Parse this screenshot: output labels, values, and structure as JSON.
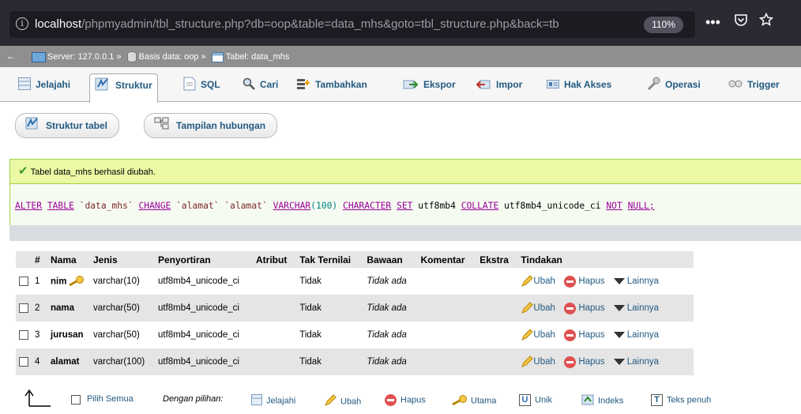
{
  "browser": {
    "url_host": "localhost",
    "url_path": "/phpmyadmin/tbl_structure.php?db=oop&table=data_mhs&goto=tbl_structure.php&back=tb",
    "zoom": "110%"
  },
  "breadcrumb": {
    "server": "Server: 127.0.0.1 »",
    "database": "Basis data: oop »",
    "table": "Tabel: data_mhs"
  },
  "tabs": [
    {
      "label": "Jelajahi"
    },
    {
      "label": "Struktur"
    },
    {
      "label": "SQL"
    },
    {
      "label": "Cari"
    },
    {
      "label": "Tambahkan"
    },
    {
      "label": "Ekspor"
    },
    {
      "label": "Impor"
    },
    {
      "label": "Hak Akses"
    },
    {
      "label": "Operasi"
    },
    {
      "label": "Trigger"
    }
  ],
  "subnav": {
    "structure": "Struktur tabel",
    "relation": "Tampilan hubungan"
  },
  "message": {
    "success": "Tabel data_mhs berhasil diubah.",
    "sql_alter": "ALTER",
    "sql_table": "TABLE",
    "sql_tbl": "`data_mhs`",
    "sql_change": "CHANGE",
    "sql_col1": "`alamat`",
    "sql_col2": "`alamat`",
    "sql_varchar": "VARCHAR",
    "sql_len": "(100)",
    "sql_character": "CHARACTER",
    "sql_set": "SET",
    "sql_charset": "utf8mb4",
    "sql_collate": "COLLATE",
    "sql_coll": "utf8mb4_unicode_ci",
    "sql_not": "NOT",
    "sql_null": "NULL;"
  },
  "table": {
    "headers": [
      "#",
      "Nama",
      "Jenis",
      "Penyortiran",
      "Atribut",
      "Tak Ternilai",
      "Bawaan",
      "Komentar",
      "Ekstra",
      "Tindakan"
    ],
    "rows": [
      {
        "num": "1",
        "name": "nim",
        "type": "varchar(10)",
        "collation": "utf8mb4_unicode_ci",
        "null": "Tidak",
        "default": "Tidak ada"
      },
      {
        "num": "2",
        "name": "nama",
        "type": "varchar(50)",
        "collation": "utf8mb4_unicode_ci",
        "null": "Tidak",
        "default": "Tidak ada"
      },
      {
        "num": "3",
        "name": "jurusan",
        "type": "varchar(50)",
        "collation": "utf8mb4_unicode_ci",
        "null": "Tidak",
        "default": "Tidak ada"
      },
      {
        "num": "4",
        "name": "alamat",
        "type": "varchar(100)",
        "collation": "utf8mb4_unicode_ci",
        "null": "Tidak",
        "default": "Tidak ada"
      }
    ],
    "actions": {
      "edit": "Ubah",
      "drop": "Hapus",
      "more": "Lainnya"
    }
  },
  "bottom": {
    "check_all": "Pilih Semua",
    "with_selected": "Dengan pilihan:",
    "browse": "Jelajahi",
    "change": "Ubah",
    "drop": "Hapus",
    "primary": "Utama",
    "unique": "Unik",
    "index": "Indeks",
    "fulltext": "Teks penuh"
  },
  "colors": {
    "link": "#235a81",
    "success_bg": "#ebf8a4",
    "browser_bar": "#2b2a33"
  }
}
